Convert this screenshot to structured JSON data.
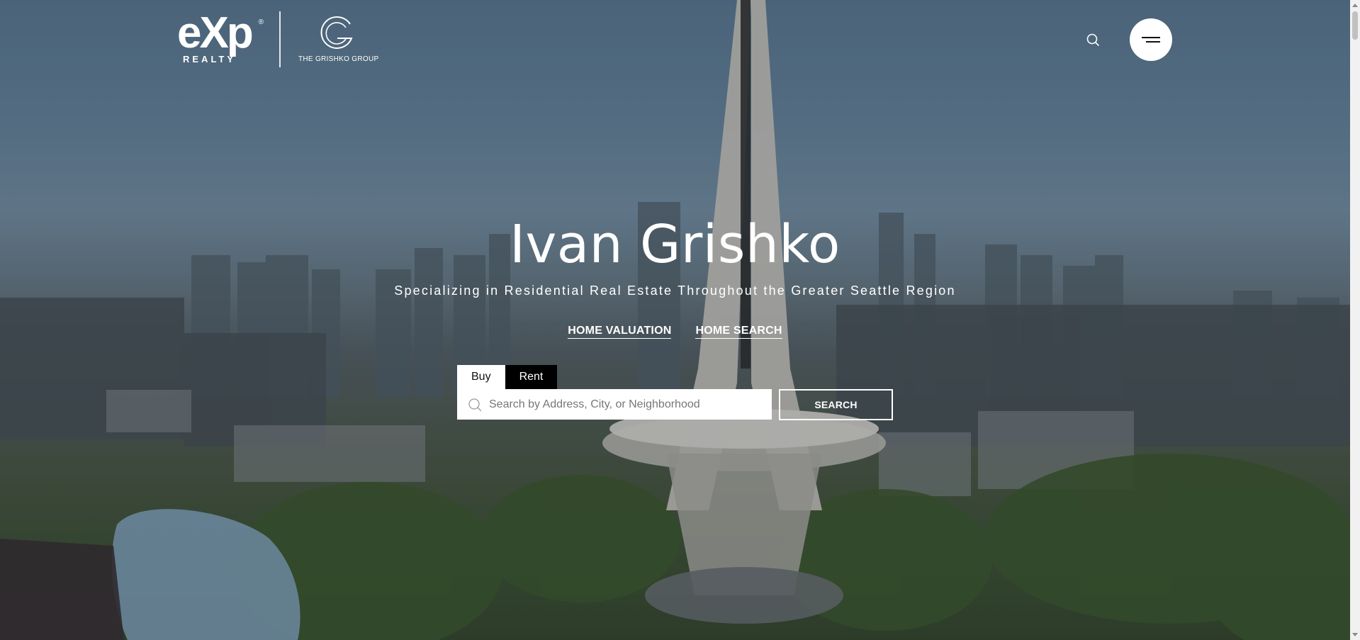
{
  "header": {
    "exp_logo_word": "eXp",
    "exp_logo_reg": "®",
    "exp_logo_sub": "REALTY",
    "group_logo_text": "THE GRISHKO GROUP"
  },
  "hero": {
    "title": "Ivan Grishko",
    "subtitle": "Specializing in Residential Real Estate Throughout the Greater Seattle Region",
    "links": {
      "home_valuation": "HOME VALUATION",
      "home_search": "HOME SEARCH"
    }
  },
  "search": {
    "tabs": {
      "buy": "Buy",
      "rent": "Rent"
    },
    "active_tab": "Buy",
    "placeholder": "Search by Address, City, or Neighborhood",
    "value": "",
    "button_label": "SEARCH"
  },
  "colors": {
    "accent_white": "#ffffff",
    "tab_inactive_bg": "#000000"
  },
  "icons": {
    "header_search": "search-icon",
    "menu": "hamburger-menu-icon",
    "input_search": "search-icon"
  }
}
